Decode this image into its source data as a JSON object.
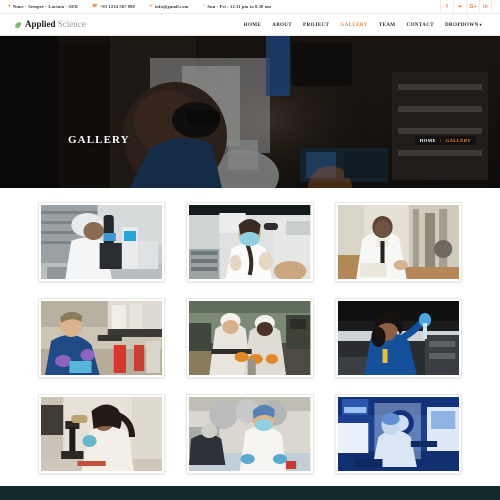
{
  "topbar": {
    "address": "Nunc - Semper - Lacinia - SED",
    "phone": "+91 1234 567 890",
    "email": "info@gmail.com",
    "hours": "Sun - Fri : 12.11 pm to 8.30 am",
    "address_icon": "location-pin-icon",
    "phone_icon": "phone-icon",
    "email_icon": "envelope-icon",
    "hours_icon": "clock-icon",
    "social": [
      {
        "name": "facebook-icon",
        "glyph": "f"
      },
      {
        "name": "twitter-icon",
        "glyph": "❧"
      },
      {
        "name": "google-plus-icon",
        "glyph": "G+"
      },
      {
        "name": "linkedin-icon",
        "glyph": "in"
      }
    ],
    "accent_color": "#e8833a"
  },
  "header": {
    "logo_icon": "leaf-icon",
    "logo_primary": "Applied",
    "logo_secondary": "Science",
    "logo_icon_color": "#7cb36a",
    "nav": [
      {
        "label": "HOME",
        "active": false
      },
      {
        "label": "ABOUT",
        "active": false
      },
      {
        "label": "PROJECT",
        "active": false
      },
      {
        "label": "GALLERY",
        "active": true
      },
      {
        "label": "TEAM",
        "active": false
      },
      {
        "label": "CONTACT",
        "active": false
      },
      {
        "label": "DROPDOWN",
        "active": false,
        "caret": "▾"
      }
    ]
  },
  "hero": {
    "title": "GALLERY",
    "breadcrumb_home": "HOME",
    "breadcrumb_separator": "/",
    "breadcrumb_current": "GALLERY",
    "image_alt": "researcher wearing vr headset in dark laboratory"
  },
  "gallery": {
    "items": [
      {
        "alt": "scientist in hairnet looking into microscope"
      },
      {
        "alt": "female researcher in mask adjusting lab equipment"
      },
      {
        "alt": "scientist in lab coat taking notes beside apparatus"
      },
      {
        "alt": "researcher in blue coveralls with purple gloves at bench"
      },
      {
        "alt": "two workers in white suits and hard hats inspecting machine"
      },
      {
        "alt": "woman in blue lab coat holding up sample vial"
      },
      {
        "alt": "woman in white coat using microscope"
      },
      {
        "alt": "technicians in scrubs and caps working at lab table"
      },
      {
        "alt": "engineers in cleanroom suits at blue-lit workstation"
      }
    ]
  },
  "footer": {
    "background_color": "#122a2b"
  }
}
